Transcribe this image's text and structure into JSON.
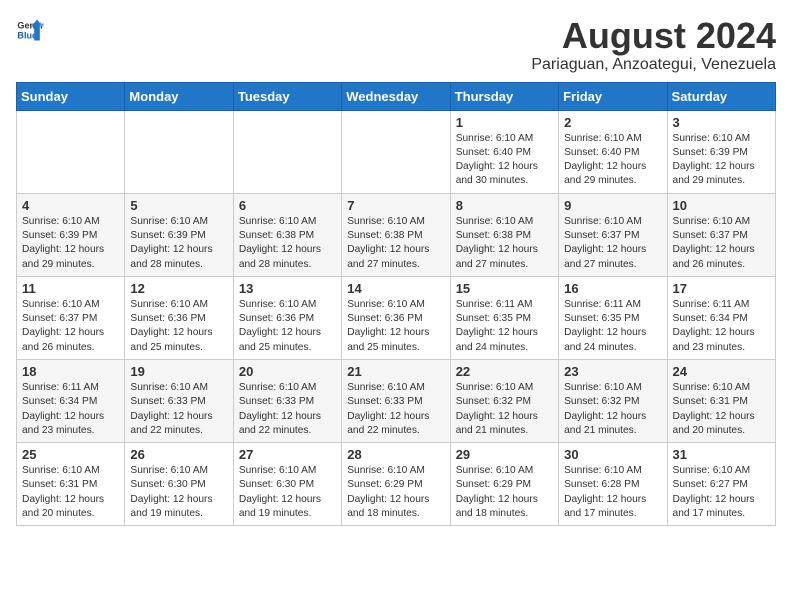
{
  "logo": {
    "general": "General",
    "blue": "Blue"
  },
  "title": "August 2024",
  "subtitle": "Pariaguan, Anzoategui, Venezuela",
  "weekdays": [
    "Sunday",
    "Monday",
    "Tuesday",
    "Wednesday",
    "Thursday",
    "Friday",
    "Saturday"
  ],
  "weeks": [
    [
      {
        "day": "",
        "info": ""
      },
      {
        "day": "",
        "info": ""
      },
      {
        "day": "",
        "info": ""
      },
      {
        "day": "",
        "info": ""
      },
      {
        "day": "1",
        "info": "Sunrise: 6:10 AM\nSunset: 6:40 PM\nDaylight: 12 hours\nand 30 minutes."
      },
      {
        "day": "2",
        "info": "Sunrise: 6:10 AM\nSunset: 6:40 PM\nDaylight: 12 hours\nand 29 minutes."
      },
      {
        "day": "3",
        "info": "Sunrise: 6:10 AM\nSunset: 6:39 PM\nDaylight: 12 hours\nand 29 minutes."
      }
    ],
    [
      {
        "day": "4",
        "info": "Sunrise: 6:10 AM\nSunset: 6:39 PM\nDaylight: 12 hours\nand 29 minutes."
      },
      {
        "day": "5",
        "info": "Sunrise: 6:10 AM\nSunset: 6:39 PM\nDaylight: 12 hours\nand 28 minutes."
      },
      {
        "day": "6",
        "info": "Sunrise: 6:10 AM\nSunset: 6:38 PM\nDaylight: 12 hours\nand 28 minutes."
      },
      {
        "day": "7",
        "info": "Sunrise: 6:10 AM\nSunset: 6:38 PM\nDaylight: 12 hours\nand 27 minutes."
      },
      {
        "day": "8",
        "info": "Sunrise: 6:10 AM\nSunset: 6:38 PM\nDaylight: 12 hours\nand 27 minutes."
      },
      {
        "day": "9",
        "info": "Sunrise: 6:10 AM\nSunset: 6:37 PM\nDaylight: 12 hours\nand 27 minutes."
      },
      {
        "day": "10",
        "info": "Sunrise: 6:10 AM\nSunset: 6:37 PM\nDaylight: 12 hours\nand 26 minutes."
      }
    ],
    [
      {
        "day": "11",
        "info": "Sunrise: 6:10 AM\nSunset: 6:37 PM\nDaylight: 12 hours\nand 26 minutes."
      },
      {
        "day": "12",
        "info": "Sunrise: 6:10 AM\nSunset: 6:36 PM\nDaylight: 12 hours\nand 25 minutes."
      },
      {
        "day": "13",
        "info": "Sunrise: 6:10 AM\nSunset: 6:36 PM\nDaylight: 12 hours\nand 25 minutes."
      },
      {
        "day": "14",
        "info": "Sunrise: 6:10 AM\nSunset: 6:36 PM\nDaylight: 12 hours\nand 25 minutes."
      },
      {
        "day": "15",
        "info": "Sunrise: 6:11 AM\nSunset: 6:35 PM\nDaylight: 12 hours\nand 24 minutes."
      },
      {
        "day": "16",
        "info": "Sunrise: 6:11 AM\nSunset: 6:35 PM\nDaylight: 12 hours\nand 24 minutes."
      },
      {
        "day": "17",
        "info": "Sunrise: 6:11 AM\nSunset: 6:34 PM\nDaylight: 12 hours\nand 23 minutes."
      }
    ],
    [
      {
        "day": "18",
        "info": "Sunrise: 6:11 AM\nSunset: 6:34 PM\nDaylight: 12 hours\nand 23 minutes."
      },
      {
        "day": "19",
        "info": "Sunrise: 6:10 AM\nSunset: 6:33 PM\nDaylight: 12 hours\nand 22 minutes."
      },
      {
        "day": "20",
        "info": "Sunrise: 6:10 AM\nSunset: 6:33 PM\nDaylight: 12 hours\nand 22 minutes."
      },
      {
        "day": "21",
        "info": "Sunrise: 6:10 AM\nSunset: 6:33 PM\nDaylight: 12 hours\nand 22 minutes."
      },
      {
        "day": "22",
        "info": "Sunrise: 6:10 AM\nSunset: 6:32 PM\nDaylight: 12 hours\nand 21 minutes."
      },
      {
        "day": "23",
        "info": "Sunrise: 6:10 AM\nSunset: 6:32 PM\nDaylight: 12 hours\nand 21 minutes."
      },
      {
        "day": "24",
        "info": "Sunrise: 6:10 AM\nSunset: 6:31 PM\nDaylight: 12 hours\nand 20 minutes."
      }
    ],
    [
      {
        "day": "25",
        "info": "Sunrise: 6:10 AM\nSunset: 6:31 PM\nDaylight: 12 hours\nand 20 minutes."
      },
      {
        "day": "26",
        "info": "Sunrise: 6:10 AM\nSunset: 6:30 PM\nDaylight: 12 hours\nand 19 minutes."
      },
      {
        "day": "27",
        "info": "Sunrise: 6:10 AM\nSunset: 6:30 PM\nDaylight: 12 hours\nand 19 minutes."
      },
      {
        "day": "28",
        "info": "Sunrise: 6:10 AM\nSunset: 6:29 PM\nDaylight: 12 hours\nand 18 minutes."
      },
      {
        "day": "29",
        "info": "Sunrise: 6:10 AM\nSunset: 6:29 PM\nDaylight: 12 hours\nand 18 minutes."
      },
      {
        "day": "30",
        "info": "Sunrise: 6:10 AM\nSunset: 6:28 PM\nDaylight: 12 hours\nand 17 minutes."
      },
      {
        "day": "31",
        "info": "Sunrise: 6:10 AM\nSunset: 6:27 PM\nDaylight: 12 hours\nand 17 minutes."
      }
    ]
  ]
}
